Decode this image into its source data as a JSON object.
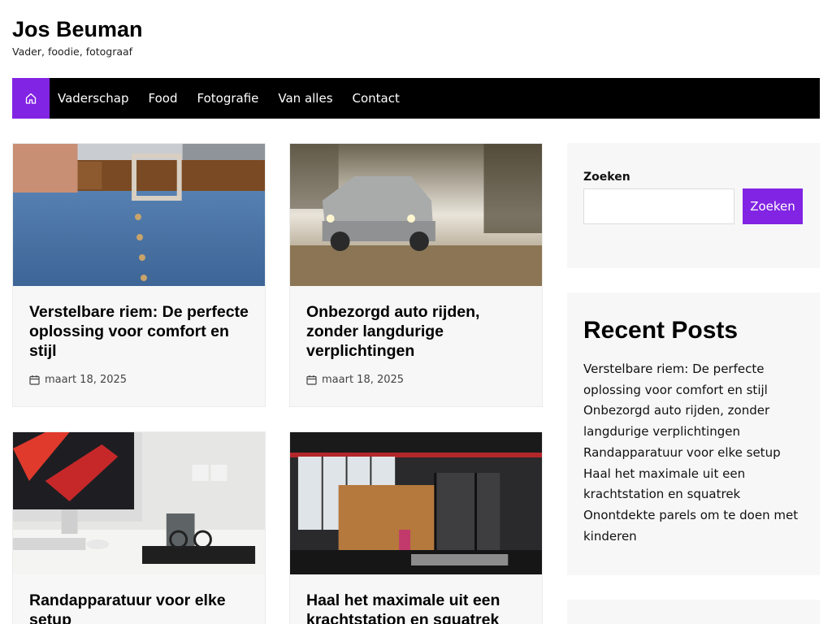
{
  "site": {
    "title": "Jos Beuman",
    "tagline": "Vader, foodie, fotograaf"
  },
  "nav": {
    "home_icon": "home-icon",
    "items": [
      "Vaderschap",
      "Food",
      "Fotografie",
      "Van alles",
      "Contact"
    ]
  },
  "posts": [
    {
      "title": "Verstelbare riem: De perfecte oplossing voor comfort en stijl",
      "date": "maart 18, 2025",
      "image": "belt-jeans-photo"
    },
    {
      "title": "Onbezorgd auto rijden, zonder langdurige verplichtingen",
      "date": "maart 18, 2025",
      "image": "suv-field-photo"
    },
    {
      "title": "Randapparatuur voor elke setup",
      "date": "",
      "image": "desk-setup-photo"
    },
    {
      "title": "Haal het maximale uit een krachtstation en squatrek",
      "date": "",
      "image": "gym-photo"
    }
  ],
  "sidebar": {
    "search": {
      "label": "Zoeken",
      "button": "Zoeken",
      "placeholder": ""
    },
    "recent": {
      "title": "Recent Posts",
      "items": [
        "Verstelbare riem: De perfecte oplossing voor comfort en stijl",
        "Onbezorgd auto rijden, zonder langdurige verplichtingen",
        "Randapparatuur voor elke setup",
        "Haal het maximale uit een krachtstation en squatrek",
        "Onontdekte parels om te doen met kinderen"
      ]
    }
  },
  "colors": {
    "accent": "#8224e3",
    "nav_bg": "#000000",
    "card_bg": "#f7f7f7"
  }
}
